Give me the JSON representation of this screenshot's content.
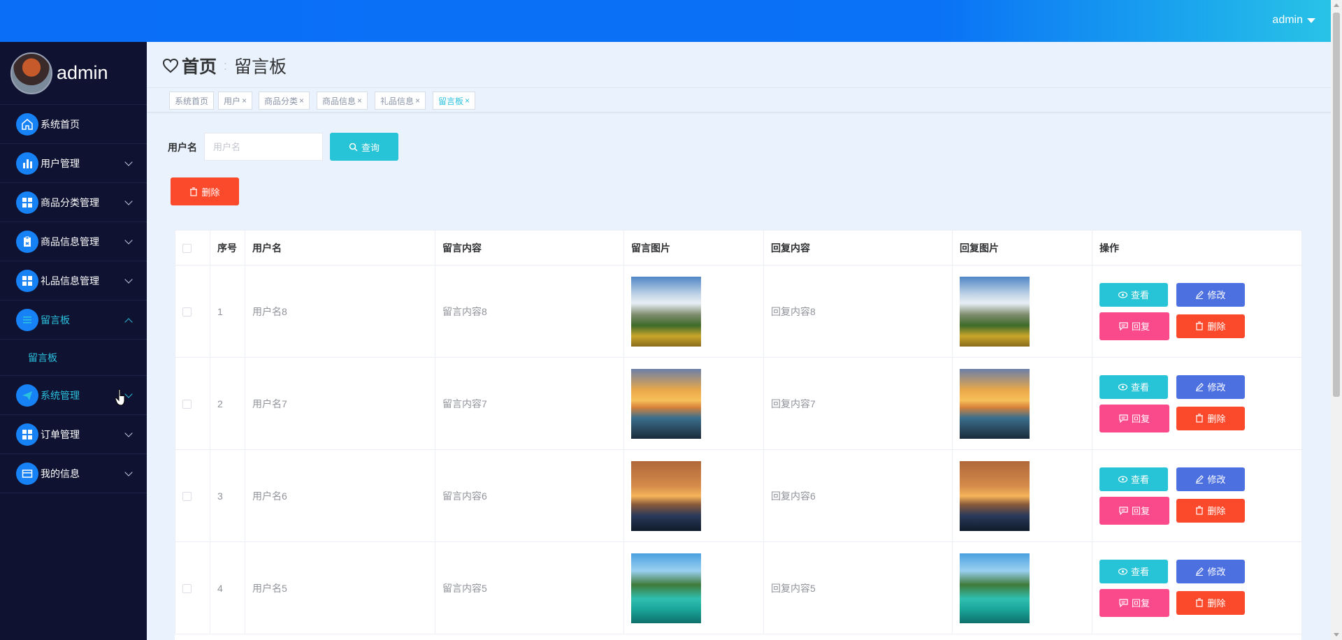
{
  "topbar": {
    "user": "admin"
  },
  "sidebar": {
    "profile_name": "admin",
    "items": [
      {
        "label": "系统首页",
        "icon": "home-icon"
      },
      {
        "label": "用户管理",
        "icon": "bar-chart-icon"
      },
      {
        "label": "商品分类管理",
        "icon": "grid-icon"
      },
      {
        "label": "商品信息管理",
        "icon": "clipboard-icon"
      },
      {
        "label": "礼品信息管理",
        "icon": "grid-icon"
      },
      {
        "label": "留言板",
        "icon": "list-icon"
      },
      {
        "label": "系统管理",
        "icon": "paper-plane-icon"
      },
      {
        "label": "订单管理",
        "icon": "grid-icon"
      },
      {
        "label": "我的信息",
        "icon": "card-icon"
      }
    ],
    "submenu": {
      "label": "留言板"
    }
  },
  "breadcrumb": {
    "home": "首页",
    "current": "留言板"
  },
  "tags": [
    "系统首页",
    "用户",
    "商品分类",
    "商品信息",
    "礼品信息",
    "留言板"
  ],
  "search": {
    "label": "用户名",
    "placeholder": "用户名",
    "button": "查询"
  },
  "batch_delete": "删除",
  "table": {
    "headers": [
      "序号",
      "用户名",
      "留言内容",
      "留言图片",
      "回复内容",
      "回复图片",
      "操作"
    ],
    "rows": [
      {
        "index": "1",
        "username": "用户名8",
        "content": "留言内容8",
        "reply": "回复内容8",
        "image": "mountain"
      },
      {
        "index": "2",
        "username": "用户名7",
        "content": "留言内容7",
        "reply": "回复内容7",
        "image": "sunset-rocks"
      },
      {
        "index": "3",
        "username": "用户名6",
        "content": "留言内容6",
        "reply": "回复内容6",
        "image": "sunset-sea"
      },
      {
        "index": "4",
        "username": "用户名5",
        "content": "留言内容5",
        "reply": "回复内容5",
        "image": "tropical"
      }
    ],
    "actions": {
      "view": "查看",
      "edit": "修改",
      "reply": "回复",
      "delete": "删除"
    }
  },
  "colors": {
    "topbar": "#0a6ef7",
    "sidebar": "#0f1331",
    "accent": "#2bc1de",
    "query_btn": "#27c3d6",
    "edit_btn": "#4c70e0",
    "reply_btn": "#fb4a8b",
    "delete_btn": "#fb4a2b"
  }
}
